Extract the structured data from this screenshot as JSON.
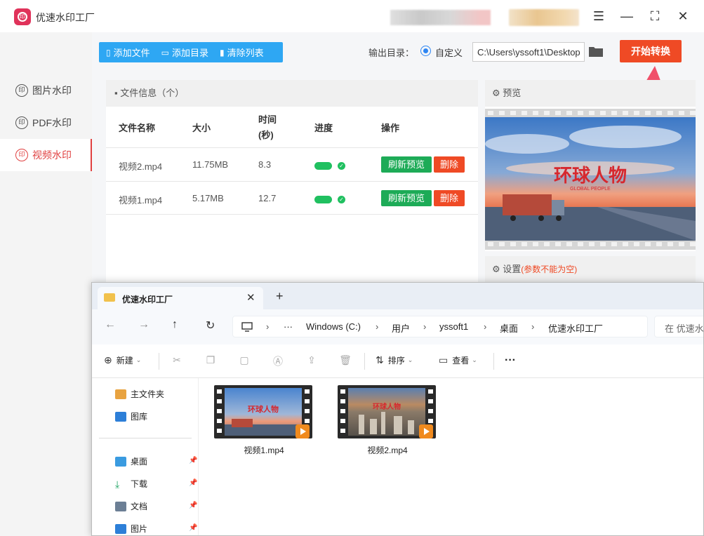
{
  "app": {
    "title": "优速水印工厂",
    "window_controls": {
      "menu": "☰",
      "minimize": "—",
      "maximize": "⛶",
      "close": "✕"
    }
  },
  "sidebar": {
    "items": [
      {
        "label": "图片水印",
        "icon": "watermark-icon",
        "active": false
      },
      {
        "label": "PDF水印",
        "icon": "watermark-icon",
        "active": false
      },
      {
        "label": "视频水印",
        "icon": "watermark-icon",
        "active": true
      }
    ]
  },
  "toolbar": {
    "add_file": "添加文件",
    "add_dir": "添加目录",
    "clear_list": "清除列表",
    "output_label": "输出目录：",
    "output_option": "自定义",
    "output_path": "C:\\Users\\yssoft1\\Desktop",
    "start_button": "开始转换"
  },
  "file_panel": {
    "title": "文件信息（个）",
    "columns": {
      "name": "文件名称",
      "size": "大小",
      "time_line1": "时间",
      "time_line2": "(秒)",
      "progress": "进度",
      "actions": "操作"
    },
    "rows": [
      {
        "name": "视频2.mp4",
        "size": "11.75MB",
        "time": "8.3",
        "progress": 1.0,
        "refresh": "刷新预览",
        "delete": "删除"
      },
      {
        "name": "视频1.mp4",
        "size": "5.17MB",
        "time": "12.7",
        "progress": 1.0,
        "refresh": "刷新预览",
        "delete": "删除"
      }
    ]
  },
  "preview": {
    "title": "预览",
    "watermark_text": "环球人物",
    "watermark_sub": "GLOBAL PEOPLE"
  },
  "settings": {
    "title": "设置",
    "warning": "(参数不能为空)"
  },
  "explorer": {
    "tab_title": "优速水印工厂",
    "new_tab": "+",
    "breadcrumbs": [
      "Windows (C:)",
      "用户",
      "yssoft1",
      "桌面",
      "优速水印工厂"
    ],
    "search_placeholder": "在 优速水印工厂 中搜索",
    "commands": {
      "new": "新建",
      "sort": "排序",
      "view": "查看",
      "more": "···"
    },
    "nav_items": [
      {
        "label": "主文件夹",
        "pinned": false
      },
      {
        "label": "图库",
        "pinned": false
      },
      {
        "label": "桌面",
        "pinned": true
      },
      {
        "label": "下载",
        "pinned": true
      },
      {
        "label": "文档",
        "pinned": true
      },
      {
        "label": "图片",
        "pinned": true
      }
    ],
    "files": [
      {
        "name": "视频1.mp4",
        "thumb_text": "环球人物"
      },
      {
        "name": "视频2.mp4",
        "thumb_text": "环球人物"
      }
    ]
  },
  "colors": {
    "accent_blue": "#2ea7f3",
    "start_red": "#ef4a25",
    "success_green": "#1dab57",
    "active_red": "#e04040"
  }
}
